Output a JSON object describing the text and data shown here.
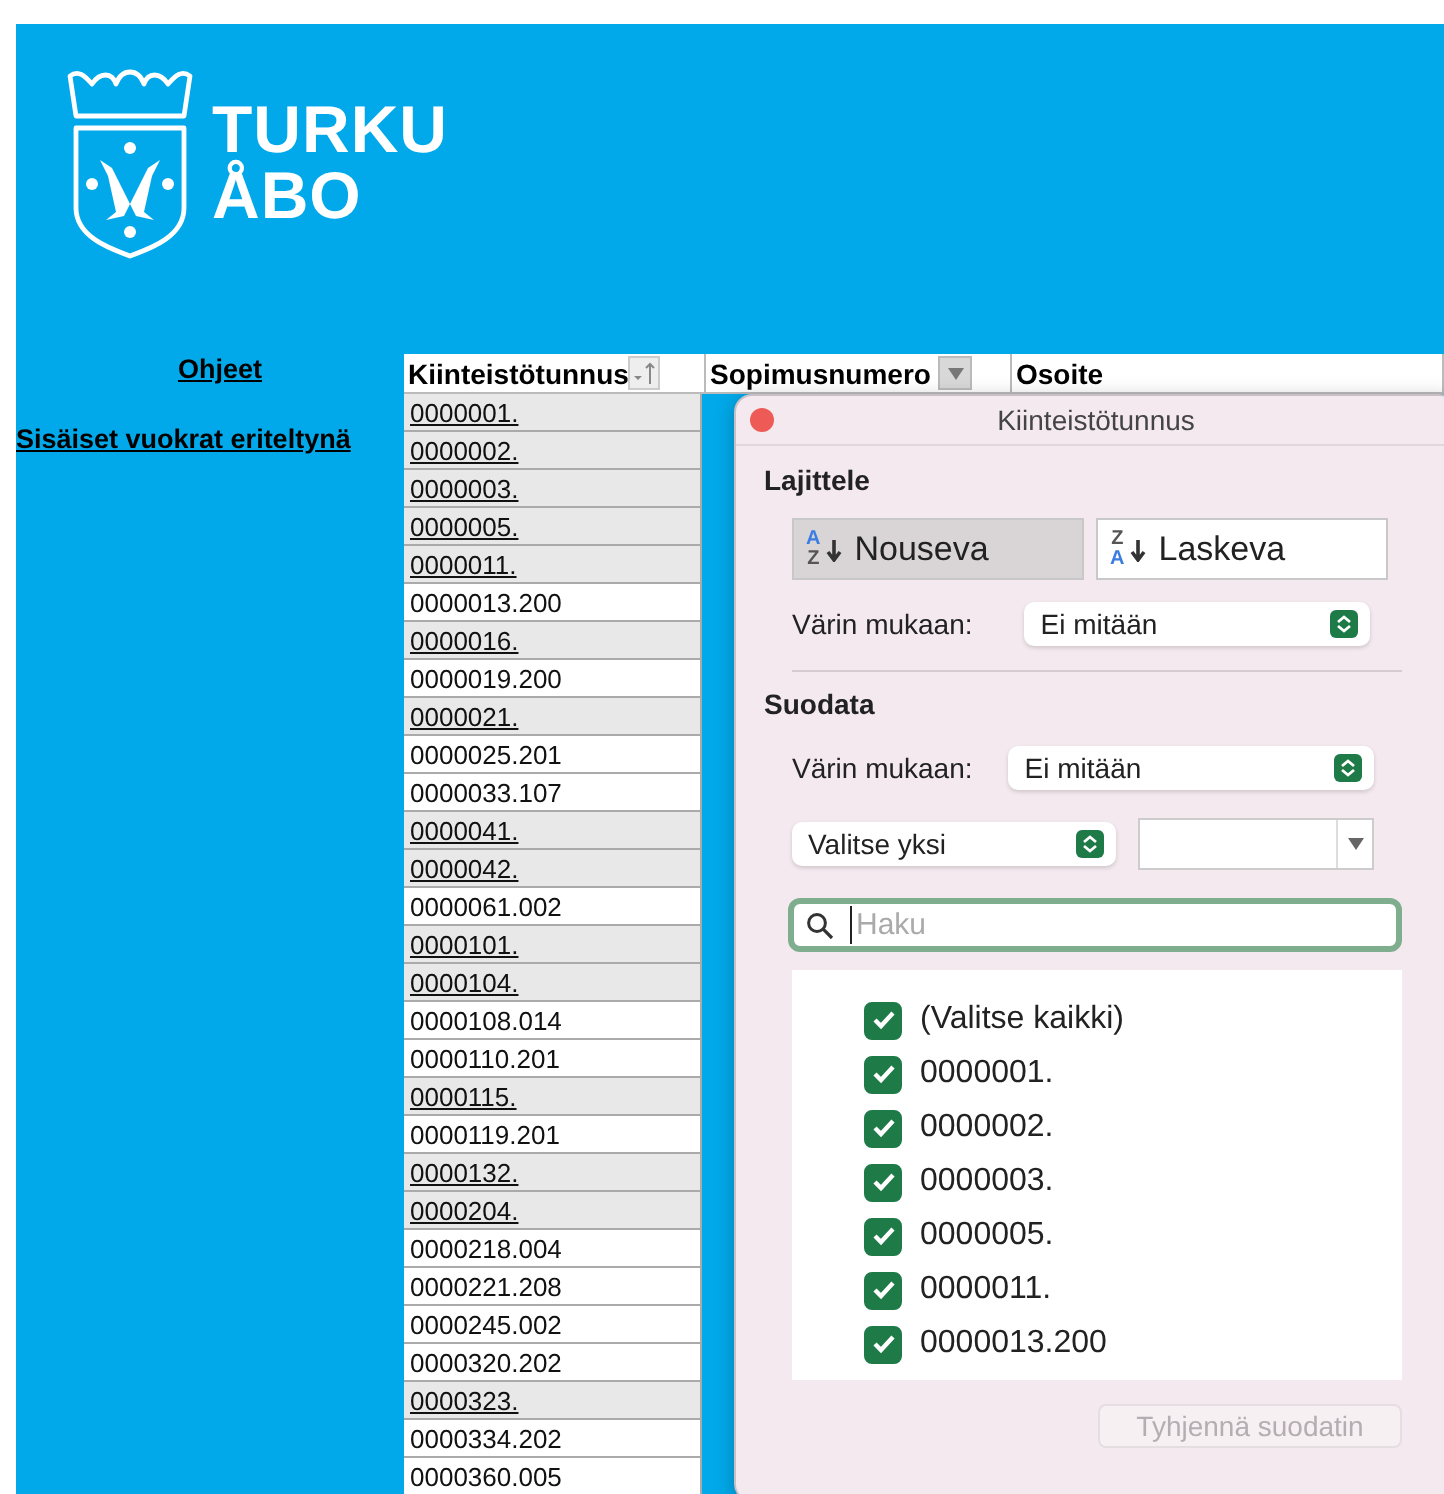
{
  "logo": {
    "lines": [
      "TURKU",
      "ÅBO"
    ]
  },
  "side_links": [
    "Ohjeet",
    "Sisäiset vuokrat eriteltynä"
  ],
  "table": {
    "columns": [
      {
        "label": "Kiinteistötunnus",
        "kind": "sorted"
      },
      {
        "label": "Sopimusnumero",
        "kind": "filter"
      },
      {
        "label": "Osoite",
        "kind": "plain"
      }
    ],
    "rows": [
      {
        "id": "0000001.",
        "link": true
      },
      {
        "id": "0000002.",
        "link": true
      },
      {
        "id": "0000003.",
        "link": true
      },
      {
        "id": "0000005.",
        "link": true
      },
      {
        "id": "0000011.",
        "link": true
      },
      {
        "id": "0000013.200",
        "link": false
      },
      {
        "id": "0000016.",
        "link": true
      },
      {
        "id": "0000019.200",
        "link": false
      },
      {
        "id": "0000021.",
        "link": true
      },
      {
        "id": "0000025.201",
        "link": false
      },
      {
        "id": "0000033.107",
        "link": false
      },
      {
        "id": "0000041.",
        "link": true
      },
      {
        "id": "0000042.",
        "link": true
      },
      {
        "id": "0000061.002",
        "link": false
      },
      {
        "id": "0000101.",
        "link": true
      },
      {
        "id": "0000104.",
        "link": true
      },
      {
        "id": "0000108.014",
        "link": false
      },
      {
        "id": "0000110.201",
        "link": false
      },
      {
        "id": "0000115.",
        "link": true
      },
      {
        "id": "0000119.201",
        "link": false
      },
      {
        "id": "0000132.",
        "link": true
      },
      {
        "id": "0000204.",
        "link": true
      },
      {
        "id": "0000218.004",
        "link": false
      },
      {
        "id": "0000221.208",
        "link": false
      },
      {
        "id": "0000245.002",
        "link": false
      },
      {
        "id": "0000320.202",
        "link": false
      },
      {
        "id": "0000323.",
        "link": true
      },
      {
        "id": "0000334.202",
        "link": false
      },
      {
        "id": "0000360.005",
        "link": false
      }
    ]
  },
  "filter_popup": {
    "title": "Kiinteistötunnus",
    "sort_heading": "Lajittele",
    "sort_buttons": [
      {
        "label": "Nouseva",
        "top": "A",
        "bottom": "Z",
        "selected": true
      },
      {
        "label": "Laskeva",
        "top": "Z",
        "bottom": "A",
        "selected": false
      }
    ],
    "sort_color_label": "Värin mukaan:",
    "sort_color_value": "Ei mitään",
    "filter_heading": "Suodata",
    "filter_color_label": "Värin mukaan:",
    "filter_color_value": "Ei mitään",
    "condition_value": "Valitse yksi",
    "search": {
      "placeholder": "Haku"
    },
    "items": [
      {
        "label": "(Valitse kaikki)",
        "checked": true
      },
      {
        "label": "0000001.",
        "checked": true
      },
      {
        "label": "0000002.",
        "checked": true
      },
      {
        "label": "0000003.",
        "checked": true
      },
      {
        "label": "0000005.",
        "checked": true
      },
      {
        "label": "0000011.",
        "checked": true
      },
      {
        "label": "0000013.200",
        "checked": true
      }
    ],
    "clear_button": {
      "label": "Tyhjennä suodatin",
      "disabled": true
    }
  }
}
